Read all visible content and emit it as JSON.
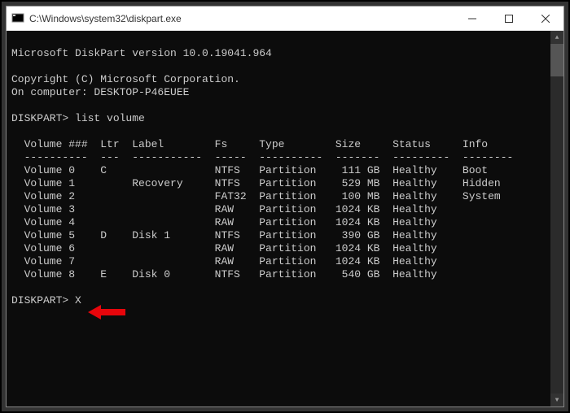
{
  "titlebar": {
    "path": "C:\\Windows\\system32\\diskpart.exe"
  },
  "header": {
    "version_line": "Microsoft DiskPart version 10.0.19041.964",
    "copyright_line": "Copyright (C) Microsoft Corporation.",
    "computer_line": "On computer: DESKTOP-P46EUEE"
  },
  "prompt1": {
    "prompt": "DISKPART>",
    "command": "list volume"
  },
  "table": {
    "headers": {
      "volume": "Volume ###",
      "ltr": "Ltr",
      "label": "Label",
      "fs": "Fs",
      "type": "Type",
      "size": "Size",
      "status": "Status",
      "info": "Info"
    },
    "divider": {
      "volume": "----------",
      "ltr": "---",
      "label": "-----------",
      "fs": "-----",
      "type": "----------",
      "size": "-------",
      "status": "---------",
      "info": "--------"
    },
    "rows": [
      {
        "volume": "Volume 0",
        "ltr": "C",
        "label": "",
        "fs": "NTFS",
        "type": "Partition",
        "size": "111 GB",
        "status": "Healthy",
        "info": "Boot"
      },
      {
        "volume": "Volume 1",
        "ltr": "",
        "label": "Recovery",
        "fs": "NTFS",
        "type": "Partition",
        "size": "529 MB",
        "status": "Healthy",
        "info": "Hidden"
      },
      {
        "volume": "Volume 2",
        "ltr": "",
        "label": "",
        "fs": "FAT32",
        "type": "Partition",
        "size": "100 MB",
        "status": "Healthy",
        "info": "System"
      },
      {
        "volume": "Volume 3",
        "ltr": "",
        "label": "",
        "fs": "RAW",
        "type": "Partition",
        "size": "1024 KB",
        "status": "Healthy",
        "info": ""
      },
      {
        "volume": "Volume 4",
        "ltr": "",
        "label": "",
        "fs": "RAW",
        "type": "Partition",
        "size": "1024 KB",
        "status": "Healthy",
        "info": ""
      },
      {
        "volume": "Volume 5",
        "ltr": "D",
        "label": "Disk 1",
        "fs": "NTFS",
        "type": "Partition",
        "size": "390 GB",
        "status": "Healthy",
        "info": ""
      },
      {
        "volume": "Volume 6",
        "ltr": "",
        "label": "",
        "fs": "RAW",
        "type": "Partition",
        "size": "1024 KB",
        "status": "Healthy",
        "info": ""
      },
      {
        "volume": "Volume 7",
        "ltr": "",
        "label": "",
        "fs": "RAW",
        "type": "Partition",
        "size": "1024 KB",
        "status": "Healthy",
        "info": ""
      },
      {
        "volume": "Volume 8",
        "ltr": "E",
        "label": "Disk 0",
        "fs": "NTFS",
        "type": "Partition",
        "size": "540 GB",
        "status": "Healthy",
        "info": ""
      }
    ]
  },
  "prompt2": {
    "prompt": "DISKPART>",
    "command": "X"
  }
}
